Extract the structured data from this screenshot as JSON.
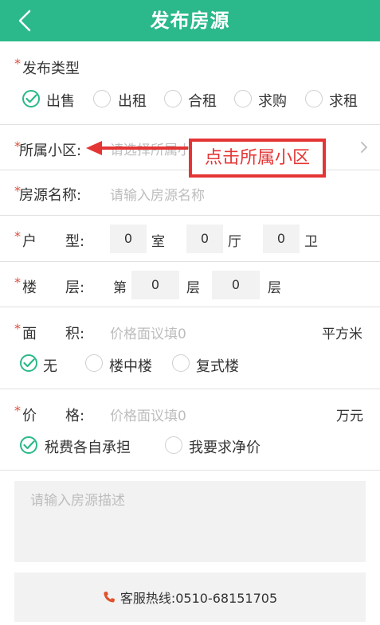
{
  "header": {
    "title": "发布房源"
  },
  "form": {
    "required_mark": "*",
    "publish_type": {
      "label": "发布类型",
      "options": [
        "出售",
        "出租",
        "合租",
        "求购",
        "求租"
      ],
      "selected": "出售"
    },
    "community": {
      "label": "所属小区:",
      "placeholder": "请选择所属小区"
    },
    "house_name": {
      "label": "房源名称:",
      "placeholder": "请输入房源名称"
    },
    "layout": {
      "label": "户　　型:",
      "rooms_value": "0",
      "rooms_unit": "室",
      "halls_value": "0",
      "halls_unit": "厅",
      "baths_value": "0",
      "baths_unit": "卫"
    },
    "floor": {
      "label": "楼　　层:",
      "prefix": "第",
      "floor_value": "0",
      "floor_unit": "层",
      "total_value": "0",
      "total_unit": "层"
    },
    "area": {
      "label": "面　　积:",
      "placeholder": "价格面议填0",
      "unit": "平方米",
      "options": [
        "无",
        "楼中楼",
        "复式楼"
      ],
      "selected": "无"
    },
    "price": {
      "label": "价　　格:",
      "placeholder": "价格面议填0",
      "unit": "万元",
      "options": [
        "税费各自承担",
        "我要求净价"
      ],
      "selected": "税费各自承担"
    },
    "description": {
      "placeholder": "请输入房源描述"
    }
  },
  "hotline": {
    "text": "客服热线:0510-68151705"
  },
  "annotation": {
    "text": "点击所属小区",
    "color": "#e43535"
  },
  "colors": {
    "accent": "#2bb88a",
    "required": "#e04d3a"
  }
}
